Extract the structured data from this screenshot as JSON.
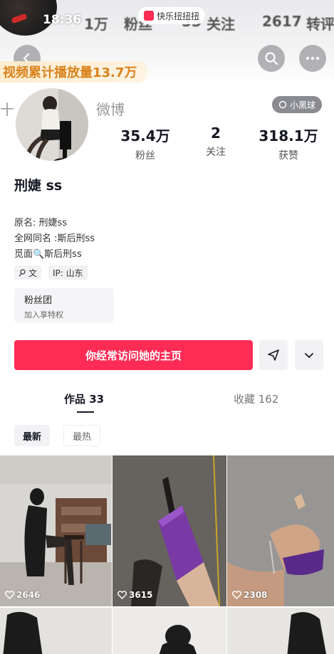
{
  "header": {
    "clock": "18:36",
    "stats_behind": [
      "1万",
      "粉丝",
      "53",
      "关注",
      "2617",
      "转评"
    ],
    "live_badge": "快乐扭扭扭",
    "play_banner": "视频累计播放量13.7万"
  },
  "profile": {
    "faded_left": "十",
    "faded_right": "微博",
    "mini_badge": "小黑球",
    "stats": [
      {
        "num": "35.4万",
        "label": "粉丝"
      },
      {
        "num": "2",
        "label": "关注"
      },
      {
        "num": "318.1万",
        "label": "获赞"
      }
    ],
    "name": "刑婕 ss",
    "info_lines": [
      "原名:   刑婕ss",
      "全网同名   :斯后刑ss",
      "觅面🔍斯后刑ss"
    ],
    "chips": [
      "文",
      "IP: 山东"
    ],
    "fan_group_title": "粉丝团",
    "fan_group_sub": "加入享特权",
    "visit_button": "你经常访问她的主页"
  },
  "tabs": {
    "works": "作品 33",
    "collection": "收藏 162"
  },
  "filters": {
    "latest": "最新",
    "hottest": "最热"
  },
  "videos": [
    {
      "likes": "2646"
    },
    {
      "likes": "3615"
    },
    {
      "likes": "2308"
    }
  ],
  "colors": {
    "accent": "#fe2c55",
    "banner_text": "#d9821c",
    "badge_bg": "#8a8b91"
  }
}
